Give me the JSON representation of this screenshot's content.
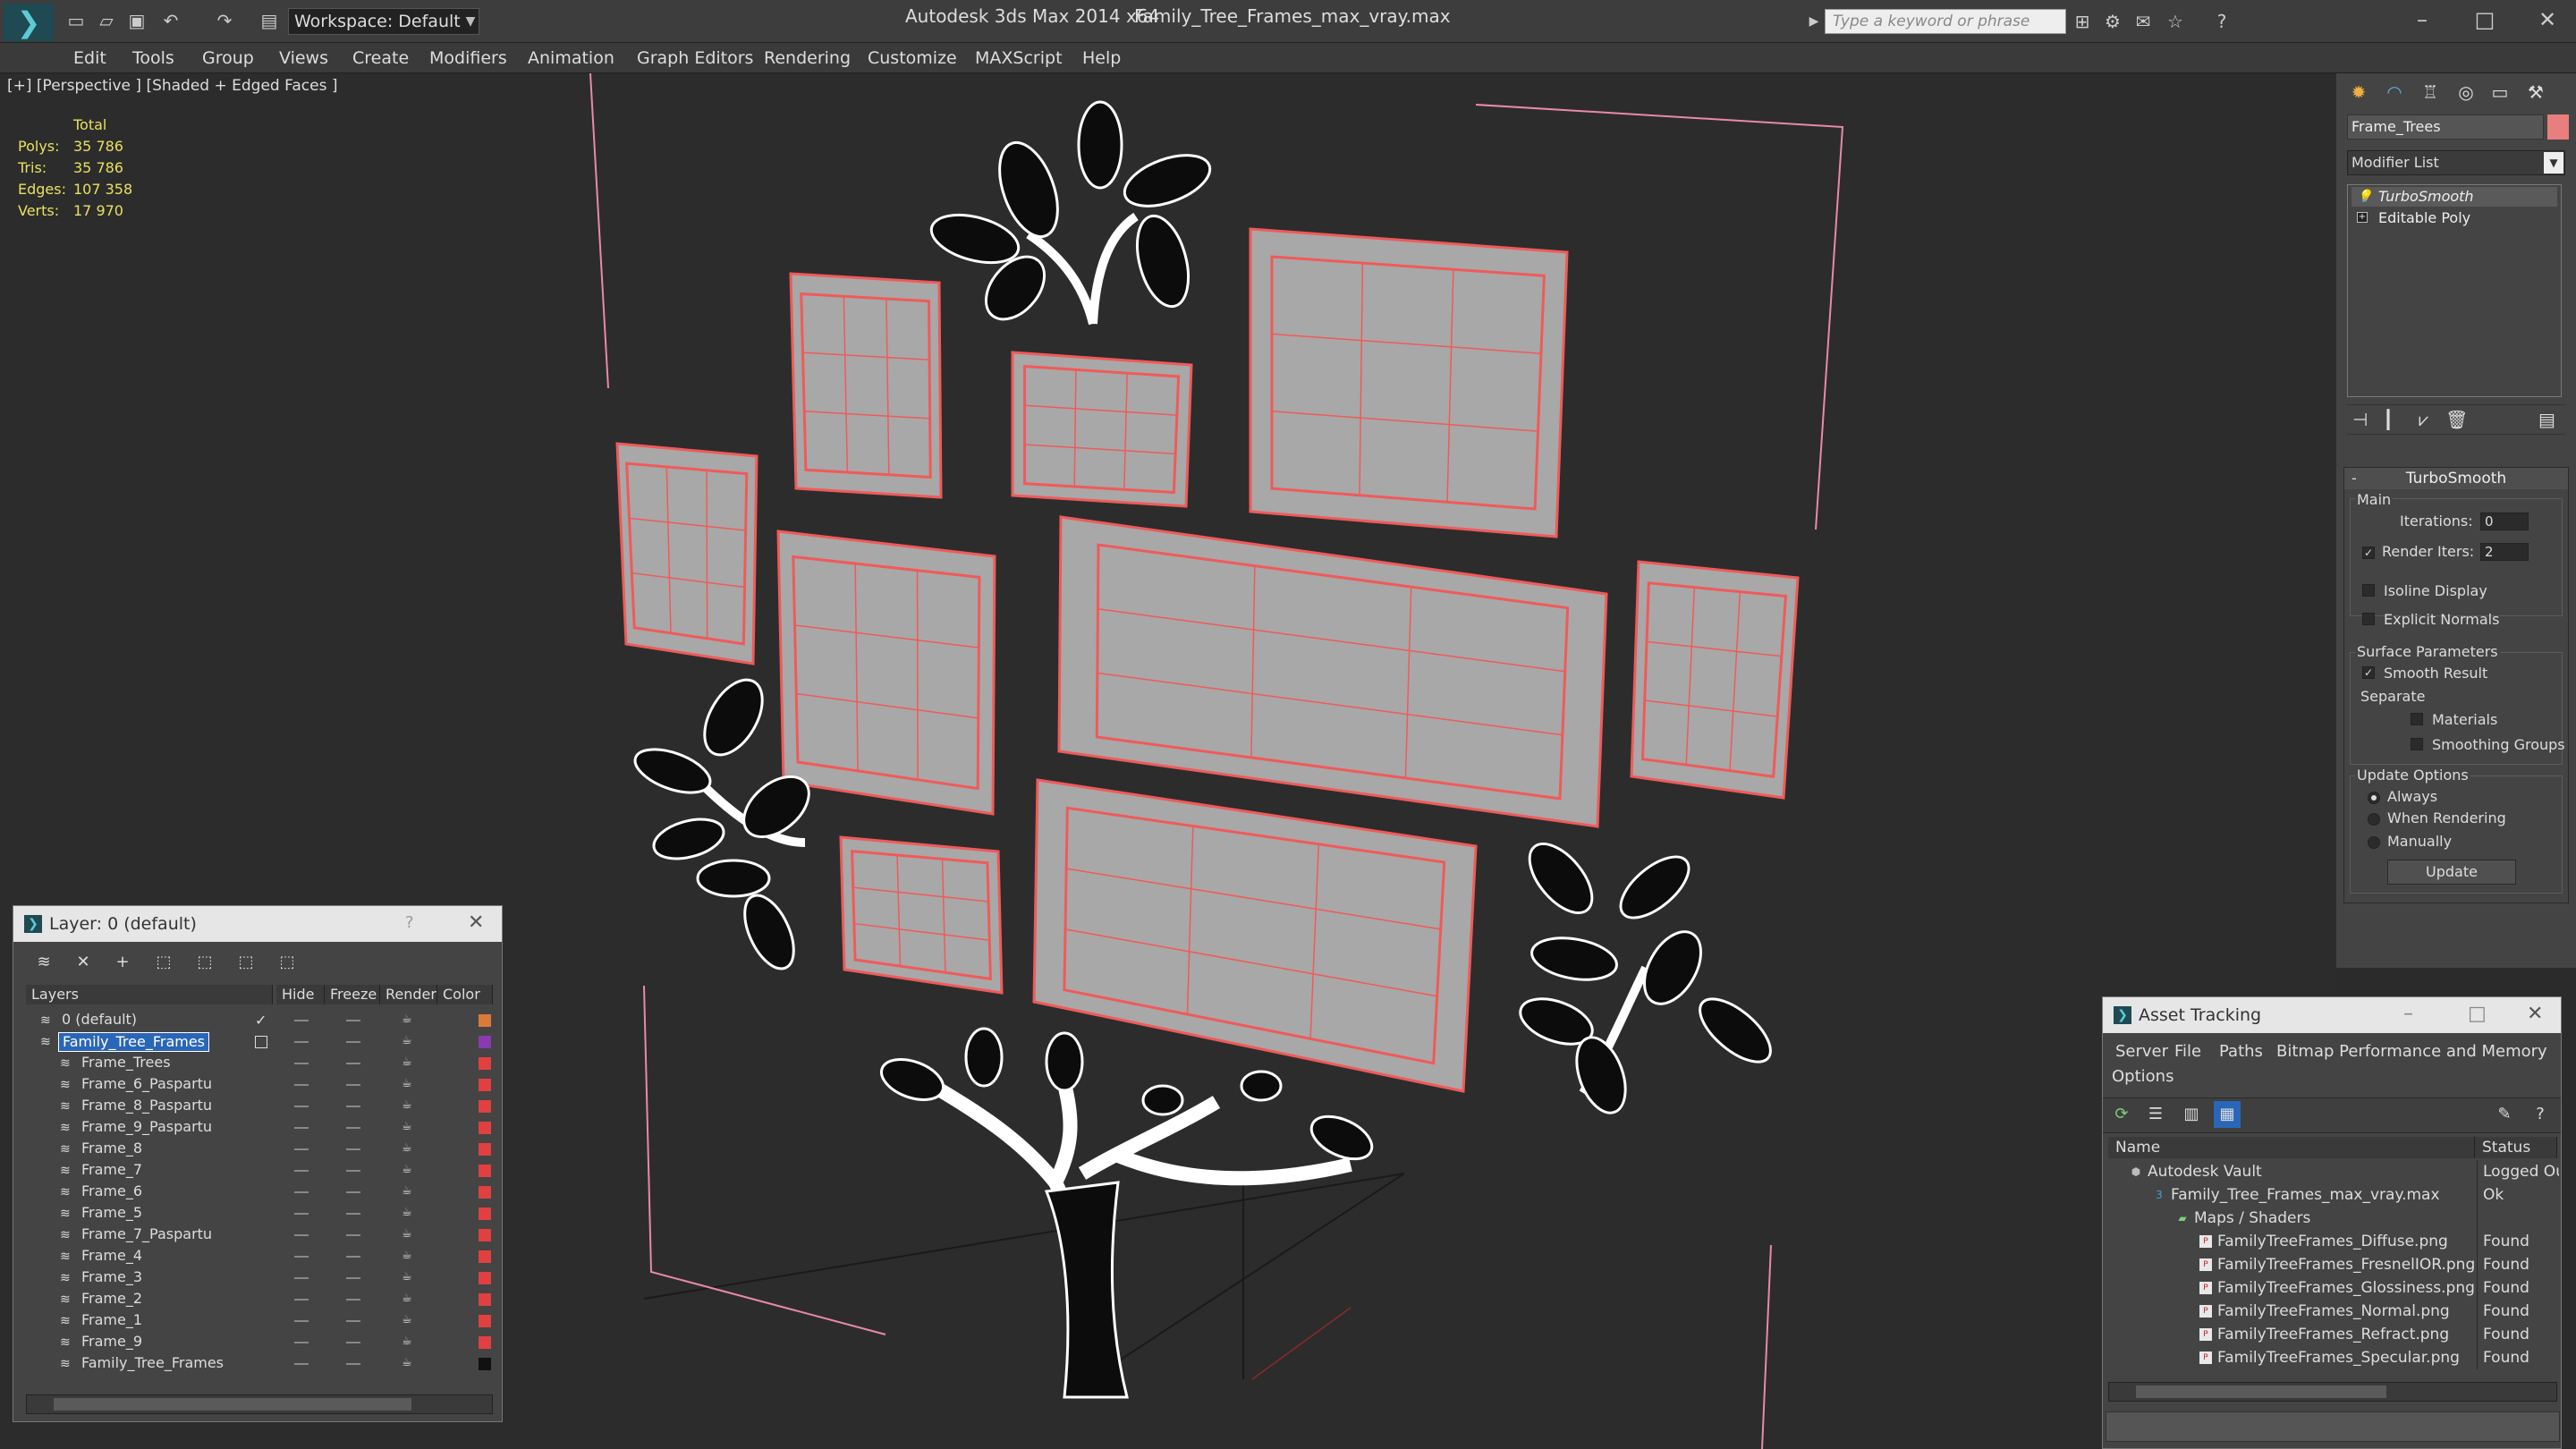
{
  "titlebar": {
    "workspace": "Workspace: Default",
    "app_title": "Autodesk 3ds Max  2014 x64",
    "file_title": "Family_Tree_Frames_max_vray.max",
    "search_placeholder": "Type a keyword or phrase"
  },
  "menu": [
    "Edit",
    "Tools",
    "Group",
    "Views",
    "Create",
    "Modifiers",
    "Animation",
    "Graph Editors",
    "Rendering",
    "Customize",
    "MAXScript",
    "Help"
  ],
  "viewport": {
    "label": "[+] [Perspective ] [Shaded + Edged Faces ]",
    "stats_header": "Total",
    "stats": [
      {
        "label": "Polys:",
        "value": "35 786"
      },
      {
        "label": "Tris:",
        "value": "35 786"
      },
      {
        "label": "Edges:",
        "value": "107 358"
      },
      {
        "label": "Verts:",
        "value": "17 970"
      }
    ]
  },
  "command_panel": {
    "object_name": "Frame_Trees",
    "object_color": "#e87e7e",
    "modifier_list": "Modifier List",
    "stack": [
      "TurboSmooth",
      "Editable Poly"
    ],
    "rollout_title": "TurboSmooth",
    "main_group": "Main",
    "iterations_label": "Iterations:",
    "iterations_value": "0",
    "render_iters_label": "Render Iters:",
    "render_iters_value": "2",
    "render_iters_checked": true,
    "isoline_label": "Isoline Display",
    "explicit_normals_label": "Explicit Normals",
    "surface_group": "Surface Parameters",
    "smooth_result_label": "Smooth Result",
    "separate_label": "Separate",
    "materials_label": "Materials",
    "smoothing_groups_label": "Smoothing Groups",
    "update_group": "Update Options",
    "always_label": "Always",
    "when_rendering_label": "When Rendering",
    "manually_label": "Manually",
    "update_button": "Update"
  },
  "layer_window": {
    "title": "Layer: 0 (default)",
    "help": "?",
    "columns": {
      "layers": "Layers",
      "hide": "Hide",
      "freeze": "Freeze",
      "render": "Render",
      "color": "Color"
    },
    "rows": [
      {
        "name": "0 (default)",
        "color": "#d97a3a",
        "indent": 0,
        "current": true
      },
      {
        "name": "Family_Tree_Frames",
        "color": "#8a3ab0",
        "indent": 0,
        "selected": true
      },
      {
        "name": "Frame_Trees",
        "color": "#e04040",
        "indent": 1
      },
      {
        "name": "Frame_6_Paspartu",
        "color": "#e04040",
        "indent": 1
      },
      {
        "name": "Frame_8_Paspartu",
        "color": "#e04040",
        "indent": 1
      },
      {
        "name": "Frame_9_Paspartu",
        "color": "#e04040",
        "indent": 1
      },
      {
        "name": "Frame_8",
        "color": "#e04040",
        "indent": 1
      },
      {
        "name": "Frame_7",
        "color": "#e04040",
        "indent": 1
      },
      {
        "name": "Frame_6",
        "color": "#e04040",
        "indent": 1
      },
      {
        "name": "Frame_5",
        "color": "#e04040",
        "indent": 1
      },
      {
        "name": "Frame_7_Paspartu",
        "color": "#e04040",
        "indent": 1
      },
      {
        "name": "Frame_4",
        "color": "#e04040",
        "indent": 1
      },
      {
        "name": "Frame_3",
        "color": "#e04040",
        "indent": 1
      },
      {
        "name": "Frame_2",
        "color": "#e04040",
        "indent": 1
      },
      {
        "name": "Frame_1",
        "color": "#e04040",
        "indent": 1
      },
      {
        "name": "Frame_9",
        "color": "#e04040",
        "indent": 1
      },
      {
        "name": "Family_Tree_Frames",
        "color": "#111111",
        "indent": 1
      }
    ]
  },
  "asset_tracking": {
    "title": "Asset Tracking",
    "menu": [
      "Server",
      "File",
      "Paths",
      "Bitmap Performance and Memory",
      "Options"
    ],
    "columns": {
      "name": "Name",
      "status": "Status"
    },
    "rows": [
      {
        "name": "Autodesk Vault",
        "status": "Logged Ou",
        "indent": 0,
        "icon": "vault-icon"
      },
      {
        "name": "Family_Tree_Frames_max_vray.max",
        "status": "Ok",
        "indent": 1,
        "icon": "max-file-icon"
      },
      {
        "name": "Maps / Shaders",
        "status": "",
        "indent": 2,
        "icon": "maps-folder-icon"
      },
      {
        "name": "FamilyTreeFrames_Diffuse.png",
        "status": "Found",
        "indent": 3,
        "icon": "png-file-icon"
      },
      {
        "name": "FamilyTreeFrames_FresnelIOR.png",
        "status": "Found",
        "indent": 3,
        "icon": "png-file-icon"
      },
      {
        "name": "FamilyTreeFrames_Glossiness.png",
        "status": "Found",
        "indent": 3,
        "icon": "png-file-icon"
      },
      {
        "name": "FamilyTreeFrames_Normal.png",
        "status": "Found",
        "indent": 3,
        "icon": "png-file-icon"
      },
      {
        "name": "FamilyTreeFrames_Refract.png",
        "status": "Found",
        "indent": 3,
        "icon": "png-file-icon"
      },
      {
        "name": "FamilyTreeFrames_Specular.png",
        "status": "Found",
        "indent": 3,
        "icon": "png-file-icon"
      }
    ]
  },
  "colors": {
    "wire_frame": "#f05a5a",
    "frame_fill": "#a8a8a8",
    "leaf_fill": "#ffffff",
    "accent": "#2a66b8"
  }
}
